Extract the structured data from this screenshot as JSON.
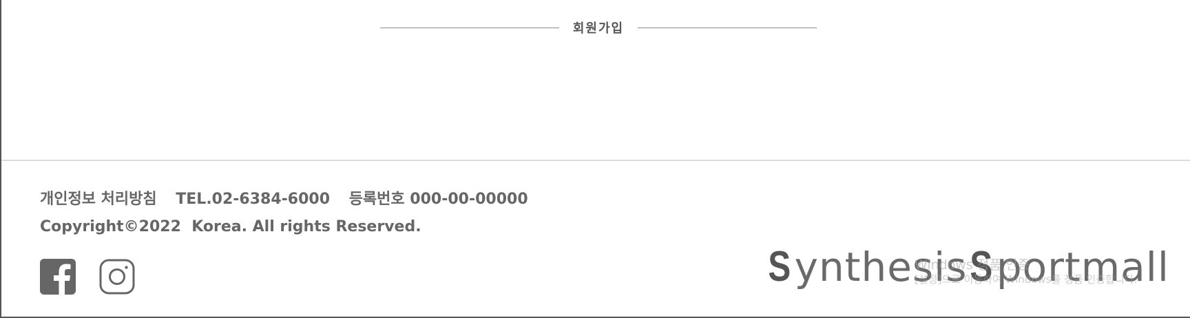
{
  "signup": {
    "label": "회원가입"
  },
  "footer": {
    "privacy_policy": "개인정보 처리방침",
    "tel": "TEL.02-6384-6000",
    "registration": "등록번호 000-00-00000",
    "copyright": "Copyright©2022  Korea. All rights Reserved."
  },
  "social": [
    {
      "icon": "facebook-icon"
    },
    {
      "icon": "instagram-icon"
    }
  ],
  "brand": {
    "s1": "S",
    "rest1": "ynthesis",
    "s2": "S",
    "rest2": "portmall"
  },
  "watermark": {
    "line1": "Windows 정품 인증",
    "line2": "[설정]으로 이동하여 Windows를 정품 인증합니다."
  },
  "colors": {
    "text": "#666666",
    "line": "#8a8a8a",
    "icon": "#666666"
  }
}
